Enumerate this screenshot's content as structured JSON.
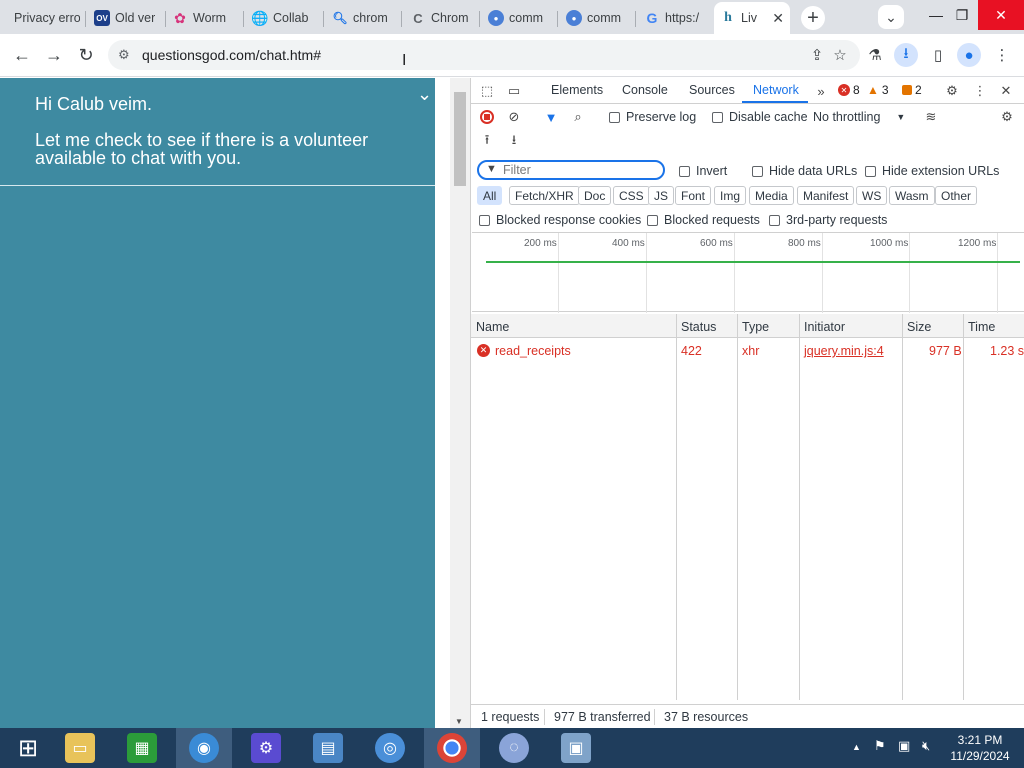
{
  "tabs": [
    {
      "label": "Privacy erro",
      "icon": "warning-icon"
    },
    {
      "label": "Old ver",
      "icon": "ov-icon"
    },
    {
      "label": "Worm",
      "icon": "flower-icon"
    },
    {
      "label": "Collab",
      "icon": "globe-icon"
    },
    {
      "label": "chrom",
      "icon": "search-icon"
    },
    {
      "label": "Chrom",
      "icon": "chrome-c-icon"
    },
    {
      "label": "comm",
      "icon": "community-icon"
    },
    {
      "label": "comm",
      "icon": "community-icon"
    },
    {
      "label": "https:/",
      "icon": "google-icon"
    },
    {
      "label": "Liv",
      "icon": "hm-icon",
      "active": true
    }
  ],
  "toolbar": {
    "url": "questionsgod.com/chat.htm#"
  },
  "chat": {
    "greeting": "Hi Calub veim.",
    "message": "Let me check to see if there is a volunteer available to chat with you."
  },
  "devtools": {
    "tabs": [
      "Elements",
      "Console",
      "Sources",
      "Network"
    ],
    "active_tab": "Network",
    "errors": "8",
    "warnings": "3",
    "issues": "2",
    "preserve_log": "Preserve log",
    "disable_cache": "Disable cache",
    "throttling": "No throttling",
    "filter_placeholder": "Filter",
    "invert": "Invert",
    "hide_data_urls": "Hide data URLs",
    "hide_extension_urls": "Hide extension URLs",
    "type_filters": [
      "All",
      "Fetch/XHR",
      "Doc",
      "CSS",
      "JS",
      "Font",
      "Img",
      "Media",
      "Manifest",
      "WS",
      "Wasm",
      "Other"
    ],
    "blocked_response_cookies": "Blocked response cookies",
    "blocked_requests": "Blocked requests",
    "third_party_requests": "3rd-party requests",
    "timeline_labels": [
      "200 ms",
      "400 ms",
      "600 ms",
      "800 ms",
      "1000 ms",
      "1200 ms"
    ],
    "columns": [
      "Name",
      "Status",
      "Type",
      "Initiator",
      "Size",
      "Time"
    ],
    "rows": [
      {
        "name": "read_receipts",
        "status": "422",
        "type": "xhr",
        "initiator": "jquery.min.js:4",
        "size": "977 B",
        "time": "1.23 s"
      }
    ],
    "summary": {
      "requests": "1 requests",
      "transferred": "977 B transferred",
      "resources": "37 B resources"
    }
  },
  "taskbar": {
    "time": "3:21 PM",
    "date": "11/29/2024"
  }
}
